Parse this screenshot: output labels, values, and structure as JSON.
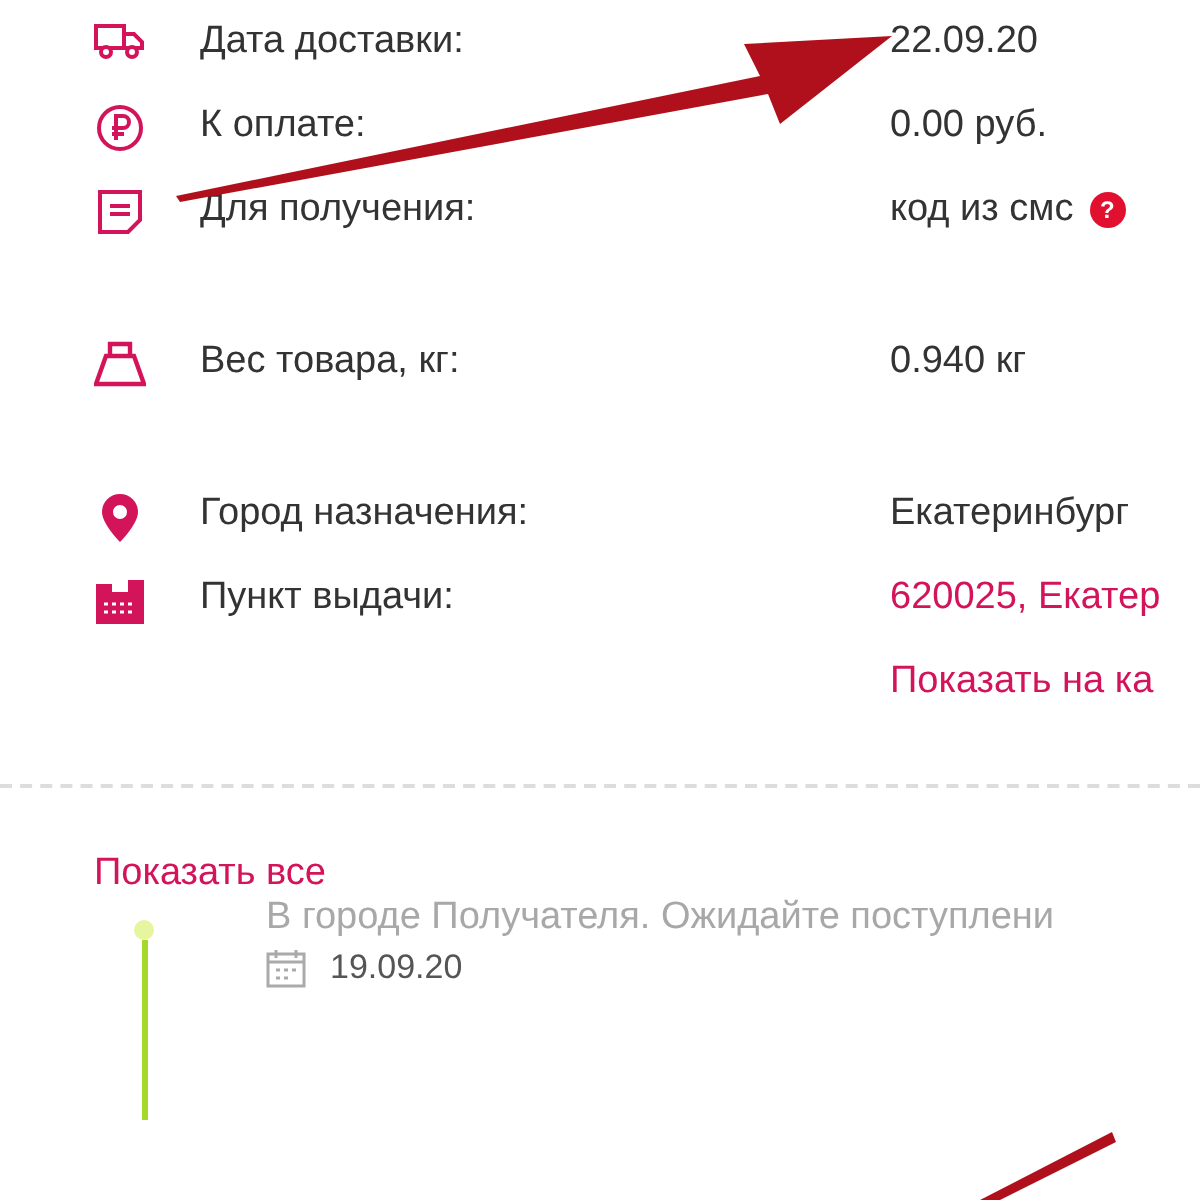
{
  "details": [
    [
      {
        "label": "Дата доставки:",
        "values": [
          {
            "text": "22.09.20",
            "kind": "text"
          }
        ]
      },
      {
        "label": "К оплате:",
        "values": [
          {
            "text": "0.00 руб.",
            "kind": "text"
          }
        ]
      },
      {
        "label": "Для получения:",
        "values": [
          {
            "text": "код из смс",
            "kind": "text"
          }
        ],
        "help": "?"
      }
    ],
    [
      {
        "label": "Вес товара, кг:",
        "values": [
          {
            "text": "0.940 кг",
            "kind": "text"
          }
        ]
      }
    ],
    [
      {
        "label": "Город назначения:",
        "values": [
          {
            "text": "Екатеринбург",
            "kind": "text"
          }
        ]
      },
      {
        "label": "Пункт выдачи:",
        "values": [
          {
            "text": "620025, Екатер",
            "kind": "link"
          },
          {
            "text": "Показать на ка",
            "kind": "link"
          }
        ]
      }
    ]
  ],
  "show_all": "Показать все",
  "history": [
    {
      "status": "В городе Получателя. Ожидайте поступлени",
      "date": "19.09.20"
    }
  ]
}
